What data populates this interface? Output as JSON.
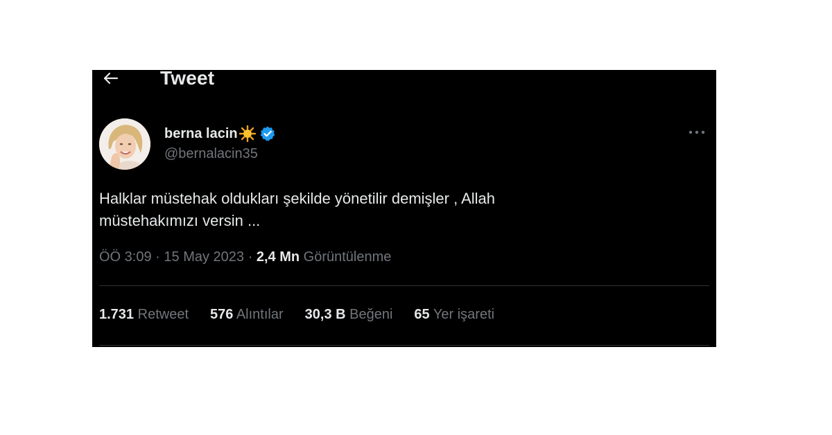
{
  "header": {
    "back_icon": "arrow-left-icon",
    "title": "Tweet"
  },
  "author": {
    "display_name": "berna lacin",
    "emoji_icon": "sun-emoji-icon",
    "verified_icon": "verified-badge-icon",
    "verified_color": "#1d9bf0",
    "handle": "@bernalacin35"
  },
  "tweet": {
    "text_line1": "Halklar müstehak oldukları şekilde yönetilir demişler , Allah",
    "text_line2": "müstehakımızı versin ..."
  },
  "meta": {
    "time": "ÖÖ 3:09",
    "separator1": "·",
    "date": "15 May 2023",
    "separator2": "·",
    "views_count": "2,4 Mn",
    "views_label": "Görüntülenme"
  },
  "stats": [
    {
      "num": "1.731",
      "label": "Retweet"
    },
    {
      "num": "576",
      "label": "Alıntılar"
    },
    {
      "num": "30,3 B",
      "label": "Beğeni"
    },
    {
      "num": "65",
      "label": "Yer işareti"
    }
  ],
  "more_icon": "more-options-icon",
  "colors": {
    "background": "#000000",
    "primary_text": "#e7e9ea",
    "secondary_text": "#71767b",
    "divider": "#2f3336"
  }
}
